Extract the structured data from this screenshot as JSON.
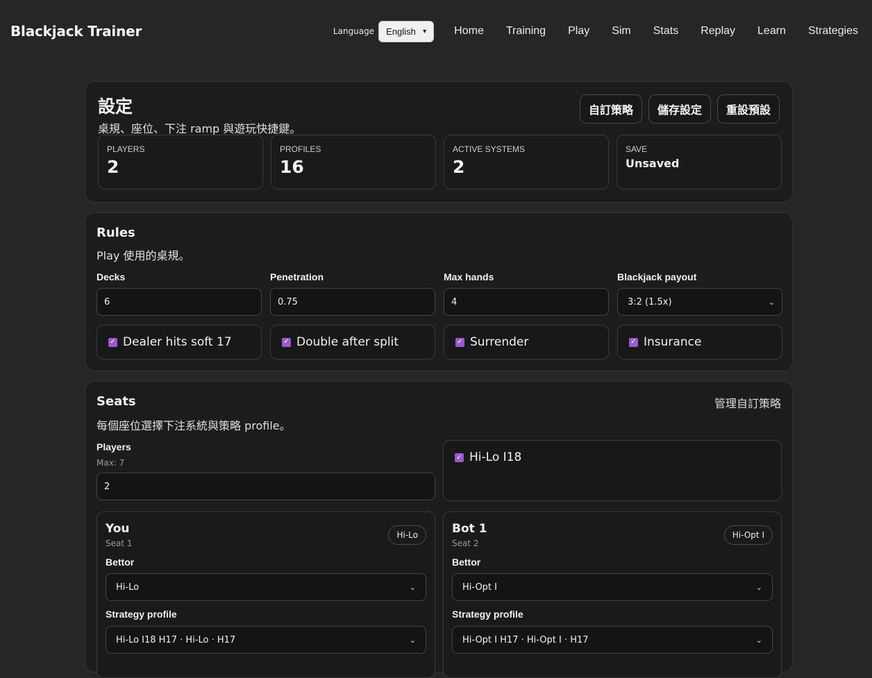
{
  "header": {
    "brand": "Blackjack Trainer",
    "language_label": "Language",
    "language_value": "English",
    "nav": [
      "Home",
      "Training",
      "Play",
      "Sim",
      "Stats",
      "Replay",
      "Learn",
      "Strategies"
    ]
  },
  "settings": {
    "title": "設定",
    "subtitle": "桌規、座位、下注 ramp 與遊玩快捷鍵。",
    "buttons": [
      "自訂策略",
      "儲存設定",
      "重設預設"
    ],
    "stats": [
      {
        "label": "Players",
        "value": "2"
      },
      {
        "label": "Profiles",
        "value": "16"
      },
      {
        "label": "Active systems",
        "value": "2"
      },
      {
        "label": "Save",
        "value": "Unsaved"
      }
    ]
  },
  "rules": {
    "title": "Rules",
    "subtitle": "Play 使用的桌規。",
    "fields": [
      {
        "label": "Decks",
        "value": "6"
      },
      {
        "label": "Penetration",
        "value": "0.75"
      },
      {
        "label": "Max hands",
        "value": "4"
      },
      {
        "label": "Blackjack payout",
        "value": "3:2 (1.5x)"
      }
    ],
    "toggles": [
      {
        "label": "Dealer hits soft 17",
        "checked": true
      },
      {
        "label": "Double after split",
        "checked": true
      },
      {
        "label": "Surrender",
        "checked": true
      },
      {
        "label": "Insurance",
        "checked": true
      }
    ]
  },
  "seats": {
    "title": "Seats",
    "subtitle": "每個座位選擇下注系統與策略 profile。",
    "manage_link": "管理自訂策略",
    "players_label": "Players",
    "players_max": "Max: 7",
    "players_value": "2",
    "systems": [
      {
        "label": "Hi-Lo I18",
        "checked": true
      }
    ],
    "seat_list": [
      {
        "name": "You",
        "seat": "Seat 1",
        "badge": "Hi-Lo",
        "bettor_label": "Bettor",
        "bettor": "Hi-Lo",
        "strategy_label": "Strategy profile",
        "strategy": "Hi-Lo I18 H17 · Hi-Lo · H17"
      },
      {
        "name": "Bot 1",
        "seat": "Seat 2",
        "badge": "Hi-Opt I",
        "bettor_label": "Bettor",
        "bettor": "Hi-Opt I",
        "strategy_label": "Strategy profile",
        "strategy": "Hi-Opt I H17 · Hi-Opt I · H17"
      }
    ]
  },
  "colors": {
    "background": "#262626",
    "panel": "#1c1c1c",
    "checkbox_accent": "#9b59c9"
  }
}
